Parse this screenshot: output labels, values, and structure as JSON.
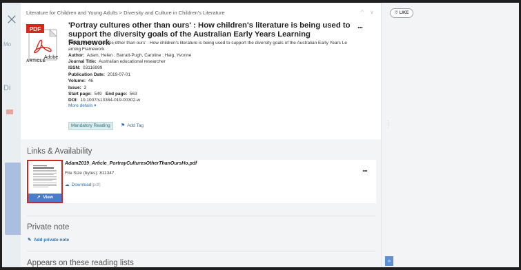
{
  "backdrop": {
    "strip_texts": [
      "Mo",
      "Di"
    ]
  },
  "close_icon": "close-icon",
  "record": {
    "breadcrumbs": "Literature for Children and Young Adults > Diversity and Culture in Children's Literature",
    "nav_arrows": "^ v",
    "pdf_badge": "PDF",
    "adobe_label": "Adobe",
    "type_label": "ARTICLE",
    "title": "'Portray cultures other than ours' : How children's literature is being used to support the diversity goals of the Australian Early Years Learning Framework",
    "more_icon": "...",
    "fields": [
      {
        "label": "Title:",
        "value": "'Portray cultures other than ours' : How children's literature is being used to support the diversity goals of the Australian Early Years Le"
      },
      {
        "label": "",
        "value": "arning Framework"
      },
      {
        "label": "Author:",
        "value": "Adam, Helen ; Barratt-Pugh, Caroline ; Haig, Yvonne"
      },
      {
        "label": "Journal Title:",
        "value": "Australian educational researcher"
      },
      {
        "label": "ISSN:",
        "value": "03116999"
      },
      {
        "label": "Publication Date:",
        "value": "2019-07-01"
      },
      {
        "label": "Volume:",
        "value": "46"
      },
      {
        "label": "Issue:",
        "value": "3"
      },
      {
        "label": "Start page:",
        "value": "549",
        "label2": "End page:",
        "value2": "563"
      },
      {
        "label": "DOI:",
        "value": "10.1007/s13384-019-00302-w"
      }
    ],
    "more_details": "More details ▾",
    "tag": "Mandatory Reading",
    "add_tag": "Add Tag"
  },
  "links": {
    "heading": "Links & Availability",
    "file_name": "Adam2019_Article_PortrayCulturesOtherThanOursHo.pdf",
    "file_size_label": "File Size (bytes):",
    "file_size": "811347",
    "download_label": "Download",
    "download_ext": "(pdf)",
    "view_label": "View",
    "more_icon": "..."
  },
  "private_note": {
    "heading": "Private note",
    "add_label": "Add private note"
  },
  "reading_lists": {
    "heading": "Appears on these reading lists"
  },
  "side": {
    "like_label": "LIKE",
    "expand_label": "»"
  },
  "colors": {
    "accent": "#2b6fb6",
    "pdf_red": "#d9261c",
    "view_button": "#4a7cc9",
    "highlight_border": "#d22323"
  }
}
